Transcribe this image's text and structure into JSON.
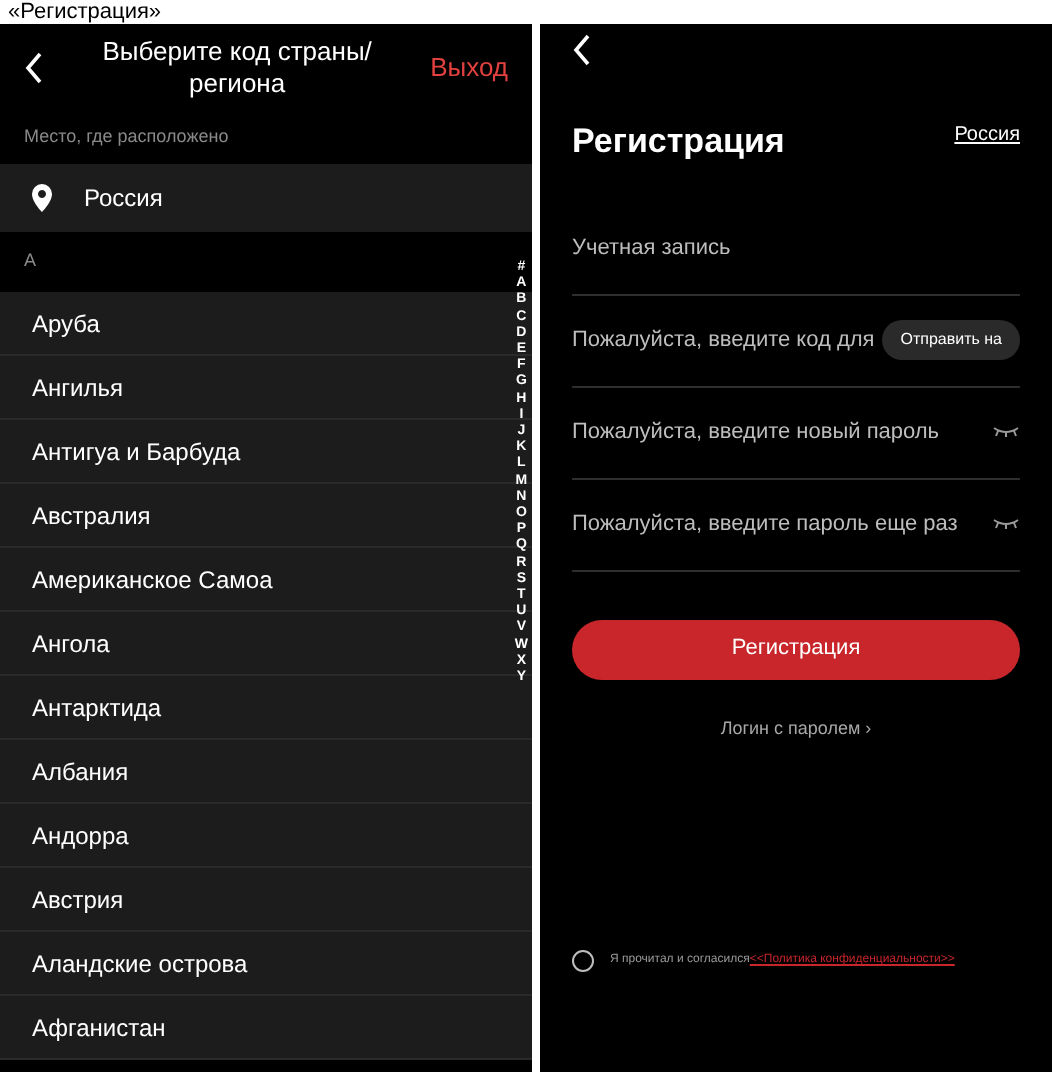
{
  "caption": "«Регистрация»",
  "country_picker": {
    "title": "Выберите код страны/",
    "title_line2": "региона",
    "exit": "Выход",
    "location_label": "Место, где расположено",
    "current_location": "Россия",
    "section_letter": "A",
    "countries": [
      "Аруба",
      "Ангилья",
      "Антигуа и Барбуда",
      "Австралия",
      "Американское Самоа",
      "Ангола",
      "Антарктида",
      "Албания",
      "Андорра",
      "Австрия",
      "Аландские острова",
      "Афганистан"
    ],
    "index_letters": [
      "#",
      "A",
      "B",
      "C",
      "D",
      "E",
      "F",
      "G",
      "H",
      "I",
      "J",
      "K",
      "L",
      "M",
      "N",
      "O",
      "P",
      "Q",
      "R",
      "S",
      "T",
      "U",
      "V",
      "W",
      "X",
      "Y"
    ]
  },
  "registration": {
    "title": "Регистрация",
    "region_link": "Россия",
    "fields": [
      {
        "kind": "text",
        "placeholder": "Учетная запись"
      },
      {
        "kind": "code",
        "placeholder": "Пожалуйста, введите код для",
        "action": "Отправить на"
      },
      {
        "kind": "password",
        "placeholder": "Пожалуйста, введите новый пароль"
      },
      {
        "kind": "password",
        "placeholder": "Пожалуйста, введите пароль еще раз"
      }
    ],
    "submit": "Регистрация",
    "password_login": "Логин с паролем",
    "password_login_chevron": "›",
    "agreement": {
      "checked": false,
      "text": "Я прочитал и согласился",
      "link": "<<Политика конфиденциальности>>"
    }
  }
}
